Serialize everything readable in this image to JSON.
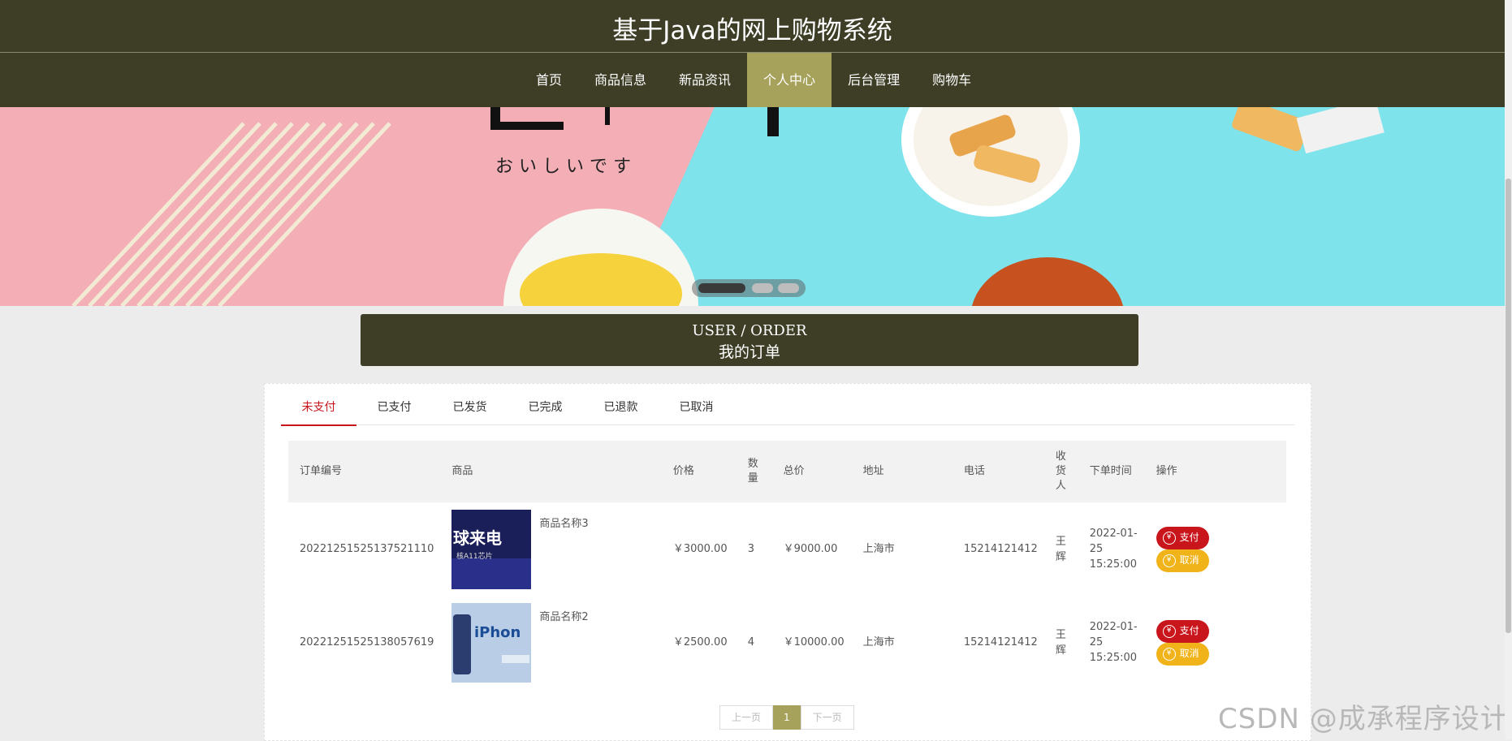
{
  "site": {
    "title": "基于Java的网上购物系统"
  },
  "nav": {
    "items": [
      "首页",
      "商品信息",
      "新品资讯",
      "个人中心",
      "后台管理",
      "购物车"
    ],
    "active_index": 3
  },
  "banner": {
    "caption": "お い し い で す",
    "slides_count": 3,
    "active_slide": 1
  },
  "section": {
    "title_en": "USER / ORDER",
    "title_cn": "我的订单"
  },
  "tabs": {
    "items": [
      "未支付",
      "已支付",
      "已发货",
      "已完成",
      "已退款",
      "已取消"
    ],
    "active_index": 0
  },
  "table": {
    "headers": [
      "订单编号",
      "商品",
      "价格",
      "数量",
      "总价",
      "地址",
      "电话",
      "收货人",
      "下单时间",
      "操作"
    ],
    "rows": [
      {
        "order_no": "20221251525137521110",
        "product": "商品名称3",
        "thumb_text": "球来电",
        "thumb_sub": "核A11芯片",
        "price": "￥3000.00",
        "qty": "3",
        "total": "￥9000.00",
        "address": "上海市",
        "phone": "15214121412",
        "receiver": "王辉",
        "time": "2022-01-25 15:25:00"
      },
      {
        "order_no": "20221251525138057619",
        "product": "商品名称2",
        "thumb_text": "iPhon",
        "thumb_sub": "",
        "price": "￥2500.00",
        "qty": "4",
        "total": "￥10000.00",
        "address": "上海市",
        "phone": "15214121412",
        "receiver": "王辉",
        "time": "2022-01-25 15:25:00"
      }
    ],
    "pay_label": "支付",
    "cancel_label": "取消",
    "currency_icon": "yen-icon"
  },
  "pager": {
    "prev": "上一页",
    "current": "1",
    "next": "下一页"
  },
  "watermark": "CSDN @成承程序设计",
  "colors": {
    "header_bg": "#3e3e27",
    "accent": "#a7a25b",
    "pay": "#c9161c",
    "cancel": "#f0b31a"
  }
}
